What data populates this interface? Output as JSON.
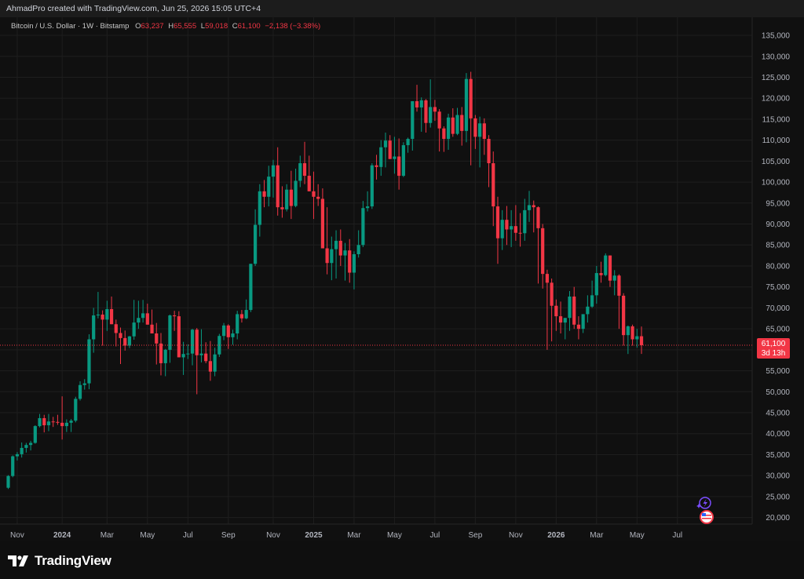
{
  "header": {
    "attribution": "AhmadPro created with TradingView.com, Jun 25, 2026 15:05 UTC+4"
  },
  "legend": {
    "symbol": "Bitcoin / U.S. Dollar · 1W · Bitstamp",
    "o_label": "O",
    "o_value": "63,237",
    "h_label": "H",
    "h_value": "65,555",
    "l_label": "L",
    "l_value": "59,018",
    "c_label": "C",
    "c_value": "61,100",
    "change": "−2,138 (−3.38%)"
  },
  "price_tag": {
    "price": "61,100",
    "countdown": "3d 13h"
  },
  "brand": {
    "name": "TradingView"
  },
  "colors": {
    "up": "#089981",
    "down": "#f23645",
    "background": "#101010",
    "grid": "#1e1e1e",
    "axis_text": "#b2b5be"
  },
  "chart_data": {
    "type": "candlestick",
    "title": "Bitcoin / U.S. Dollar · 1W · Bitstamp",
    "y_axis_side": "right",
    "ylim": [
      16000,
      138000
    ],
    "yticks": [
      20000,
      25000,
      30000,
      35000,
      40000,
      45000,
      50000,
      55000,
      60000,
      65000,
      70000,
      75000,
      80000,
      85000,
      90000,
      95000,
      100000,
      105000,
      110000,
      115000,
      120000,
      125000,
      130000,
      135000
    ],
    "ytick_labels": [
      "20,000",
      "25,000",
      "30,000",
      "35,000",
      "40,000",
      "45,000",
      "50,000",
      "55,000",
      "60,000",
      "65,000",
      "70,000",
      "75,000",
      "80,000",
      "85,000",
      "90,000",
      "95,000",
      "100,000",
      "105,000",
      "110,000",
      "115,000",
      "120,000",
      "125,000",
      "130,000",
      "135,000"
    ],
    "xticks": [
      {
        "label": "Nov",
        "week": 2
      },
      {
        "label": "2024",
        "week": 12
      },
      {
        "label": "Mar",
        "week": 22
      },
      {
        "label": "May",
        "week": 31
      },
      {
        "label": "Jul",
        "week": 40
      },
      {
        "label": "Sep",
        "week": 49
      },
      {
        "label": "Nov",
        "week": 59
      },
      {
        "label": "2025",
        "week": 68
      },
      {
        "label": "Mar",
        "week": 77
      },
      {
        "label": "May",
        "week": 86
      },
      {
        "label": "Jul",
        "week": 95
      },
      {
        "label": "Sep",
        "week": 104
      },
      {
        "label": "Nov",
        "week": 113
      },
      {
        "label": "2026",
        "week": 122
      },
      {
        "label": "Mar",
        "week": 131
      },
      {
        "label": "May",
        "week": 140
      },
      {
        "label": "Jul",
        "week": 149
      }
    ],
    "last_price": 61100,
    "grid": true,
    "candles": [
      [
        27100,
        30100,
        26800,
        29900
      ],
      [
        29900,
        34800,
        29600,
        34600
      ],
      [
        34600,
        35600,
        33600,
        35100
      ],
      [
        35100,
        37900,
        34300,
        36600
      ],
      [
        36600,
        37800,
        35500,
        37300
      ],
      [
        37300,
        38300,
        36000,
        37800
      ],
      [
        37800,
        42000,
        37600,
        41800
      ],
      [
        41800,
        44700,
        41500,
        43700
      ],
      [
        43700,
        44500,
        40300,
        42000
      ],
      [
        42000,
        44700,
        40600,
        42900
      ],
      [
        42900,
        44000,
        41600,
        42800
      ],
      [
        42800,
        44500,
        42100,
        42600
      ],
      [
        42600,
        48900,
        38600,
        41800
      ],
      [
        41800,
        43400,
        40400,
        42600
      ],
      [
        42600,
        43500,
        40400,
        43100
      ],
      [
        43100,
        48800,
        42700,
        48300
      ],
      [
        48300,
        52500,
        47900,
        51600
      ],
      [
        51600,
        53000,
        50500,
        52000
      ],
      [
        52000,
        63700,
        50600,
        62500
      ],
      [
        62500,
        70000,
        59300,
        68200
      ],
      [
        68200,
        73800,
        67500,
        68400
      ],
      [
        68400,
        69400,
        61000,
        67200
      ],
      [
        67200,
        71700,
        64500,
        69700
      ],
      [
        69700,
        72700,
        68100,
        66100
      ],
      [
        66100,
        67200,
        60800,
        64000
      ],
      [
        64000,
        65300,
        56600,
        62800
      ],
      [
        62800,
        64600,
        59800,
        61000
      ],
      [
        61000,
        63300,
        60400,
        63200
      ],
      [
        63200,
        71900,
        62400,
        66500
      ],
      [
        66500,
        71700,
        65000,
        67600
      ],
      [
        67600,
        71900,
        66500,
        68700
      ],
      [
        68700,
        71000,
        66000,
        66000
      ],
      [
        66000,
        69600,
        64200,
        63900
      ],
      [
        63900,
        66400,
        56500,
        61500
      ],
      [
        61500,
        64000,
        53900,
        56800
      ],
      [
        56800,
        60200,
        53700,
        60000
      ],
      [
        60000,
        68400,
        56900,
        68200
      ],
      [
        68200,
        69300,
        64500,
        68000
      ],
      [
        68000,
        69200,
        59200,
        58200
      ],
      [
        58200,
        61900,
        54000,
        59000
      ],
      [
        59000,
        61300,
        57800,
        59100
      ],
      [
        59100,
        65000,
        56300,
        64800
      ],
      [
        64800,
        65200,
        49400,
        58700
      ],
      [
        58700,
        64900,
        57000,
        59100
      ],
      [
        59100,
        61800,
        56800,
        57300
      ],
      [
        57300,
        62100,
        52600,
        54800
      ],
      [
        54800,
        60500,
        53700,
        58900
      ],
      [
        58900,
        63800,
        58300,
        63300
      ],
      [
        63300,
        66400,
        62300,
        65800
      ],
      [
        65800,
        66100,
        60200,
        63000
      ],
      [
        63000,
        64800,
        61200,
        63900
      ],
      [
        63900,
        69300,
        62500,
        68500
      ],
      [
        68500,
        69500,
        66500,
        67500
      ],
      [
        67500,
        72000,
        67300,
        69500
      ],
      [
        69500,
        77000,
        69000,
        80500
      ],
      [
        80500,
        93500,
        80000,
        89800
      ],
      [
        89800,
        99500,
        87000,
        97800
      ],
      [
        97800,
        100500,
        94000,
        96500
      ],
      [
        96500,
        103900,
        94200,
        101300
      ],
      [
        101300,
        105300,
        96300,
        104000
      ],
      [
        104000,
        108300,
        92000,
        94000
      ],
      [
        94000,
        99000,
        91500,
        93500
      ],
      [
        93500,
        99500,
        93000,
        98200
      ],
      [
        98200,
        102700,
        91200,
        94300
      ],
      [
        94300,
        103200,
        94000,
        100300
      ],
      [
        100300,
        106300,
        98800,
        104500
      ],
      [
        104500,
        109600,
        99500,
        101500
      ],
      [
        101500,
        106300,
        97800,
        97800
      ],
      [
        97800,
        102500,
        91200,
        96500
      ],
      [
        96500,
        99500,
        94300,
        96000
      ],
      [
        96000,
        98500,
        86000,
        84200
      ],
      [
        84200,
        94000,
        78000,
        80700
      ],
      [
        80700,
        87000,
        76600,
        84000
      ],
      [
        84000,
        88500,
        77000,
        86000
      ],
      [
        86000,
        88700,
        80000,
        82500
      ],
      [
        82500,
        85500,
        76500,
        83700
      ],
      [
        83700,
        86400,
        76000,
        78400
      ],
      [
        78400,
        83500,
        74400,
        82800
      ],
      [
        82800,
        88500,
        82000,
        85000
      ],
      [
        85000,
        95500,
        84500,
        93800
      ],
      [
        93800,
        97800,
        93000,
        94200
      ],
      [
        94200,
        104500,
        93600,
        104000
      ],
      [
        104000,
        106500,
        100600,
        103600
      ],
      [
        103600,
        110000,
        101500,
        108300
      ],
      [
        108300,
        111800,
        103500,
        109900
      ],
      [
        109900,
        111200,
        106800,
        105500
      ],
      [
        105500,
        110800,
        102000,
        106100
      ],
      [
        106100,
        110400,
        98200,
        101500
      ],
      [
        101500,
        109500,
        101200,
        108800
      ],
      [
        108800,
        110600,
        107000,
        110300
      ],
      [
        110300,
        118900,
        107500,
        119300
      ],
      [
        119300,
        123200,
        116800,
        117800
      ],
      [
        117800,
        120200,
        112000,
        119500
      ],
      [
        119500,
        119800,
        111800,
        114100
      ],
      [
        114100,
        124500,
        113000,
        117900
      ],
      [
        117900,
        119600,
        114600,
        116800
      ],
      [
        116800,
        117400,
        107300,
        112800
      ],
      [
        112800,
        113300,
        107200,
        110300
      ],
      [
        110300,
        116300,
        107700,
        115400
      ],
      [
        115400,
        117600,
        110800,
        111500
      ],
      [
        111500,
        117700,
        111200,
        116000
      ],
      [
        116000,
        117900,
        108700,
        112200
      ],
      [
        112200,
        126000,
        109500,
        124600
      ],
      [
        124600,
        126300,
        104000,
        115200
      ],
      [
        115200,
        116000,
        107900,
        110800
      ],
      [
        110800,
        115600,
        103500,
        114000
      ],
      [
        114000,
        115200,
        106500,
        110300
      ],
      [
        110300,
        111200,
        98800,
        104500
      ],
      [
        104500,
        107300,
        89500,
        94200
      ],
      [
        94200,
        96500,
        80500,
        86600
      ],
      [
        86600,
        93300,
        83800,
        91000
      ],
      [
        91000,
        94300,
        85000,
        88700
      ],
      [
        88700,
        93300,
        84500,
        89500
      ],
      [
        89500,
        94500,
        86000,
        87900
      ],
      [
        87900,
        92600,
        84600,
        87800
      ],
      [
        87800,
        96000,
        86000,
        93300
      ],
      [
        93300,
        97900,
        90500,
        94500
      ],
      [
        94500,
        95600,
        88000,
        94000
      ],
      [
        94000,
        94200,
        75800,
        89000
      ],
      [
        89000,
        90000,
        74600,
        78100
      ],
      [
        78100,
        79100,
        60000,
        76000
      ],
      [
        76000,
        77000,
        62000,
        70500
      ],
      [
        70500,
        72000,
        64500,
        68000
      ],
      [
        68000,
        71500,
        63900,
        66500
      ],
      [
        66500,
        67500,
        62500,
        67600
      ],
      [
        67600,
        74000,
        64500,
        72700
      ],
      [
        72700,
        75000,
        65000,
        66000
      ],
      [
        66000,
        68000,
        62500,
        65000
      ],
      [
        65000,
        68500,
        64000,
        68500
      ],
      [
        68500,
        73000,
        66500,
        70300
      ],
      [
        70300,
        76500,
        70000,
        73000
      ],
      [
        73000,
        80000,
        71000,
        78300
      ],
      [
        78300,
        81000,
        76000,
        77800
      ],
      [
        77800,
        83000,
        77500,
        82500
      ],
      [
        82500,
        82000,
        75000,
        76500
      ],
      [
        76500,
        79000,
        73000,
        77700
      ],
      [
        77700,
        78000,
        65000,
        72900
      ],
      [
        72900,
        73500,
        61000,
        63500
      ],
      [
        63500,
        65800,
        59000,
        65600
      ],
      [
        65600,
        66000,
        61000,
        62500
      ],
      [
        62500,
        65000,
        60500,
        63237
      ],
      [
        63237,
        65555,
        59018,
        61100
      ]
    ]
  }
}
